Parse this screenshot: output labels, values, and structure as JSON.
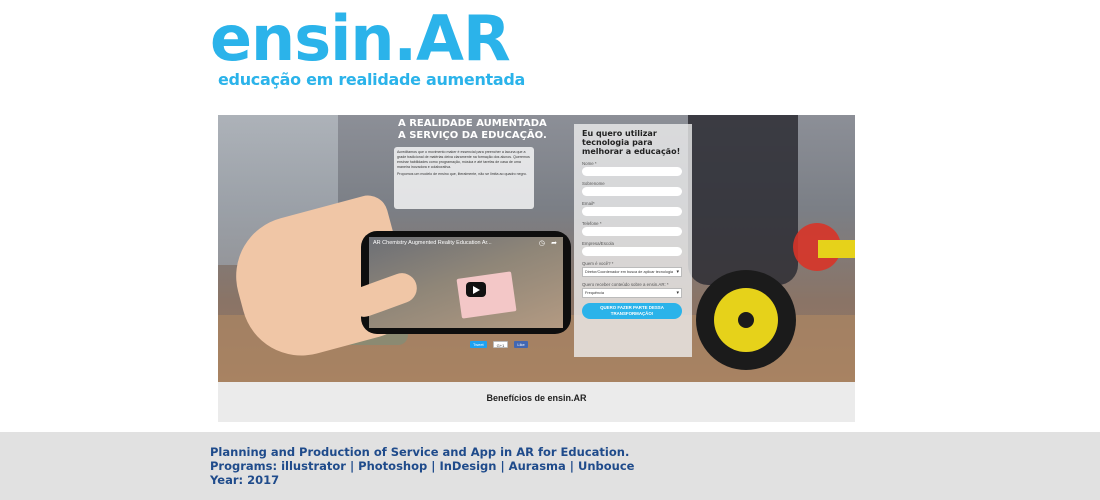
{
  "brand": {
    "name": "ensin.AR",
    "tagline": "educação em realidade aumentada",
    "accent_color": "#2bb3ea"
  },
  "hero": {
    "headline_line1": "A REALIDADE AUMENTADA",
    "headline_line2": "A SERVIÇO DA EDUCAÇÃO.",
    "paragraph1": "Acreditamos que o movimento maker é essencial para preencher a lacuna que a grade tradicional de matérias deixa claramente na formação dos alunos. Queremos ensinar habilidades como programação, música e até tarefas de casa de uma maneira inovadora e colaborativa.",
    "paragraph2": "Propomos um modelo de ensino que, literalmente, não se limita ao quadro negro.",
    "video": {
      "title": "AR Chemistry Augmented Reality Education Ar...",
      "clock_icon": "clock-icon",
      "share_icon": "share-icon",
      "play_icon": "play-icon"
    },
    "social": {
      "tweet": "Tweet",
      "gplus": "G+1",
      "like": "Like"
    }
  },
  "form": {
    "title": "Eu quero utilizar tecnologia para melhorar a educação!",
    "fields": {
      "nome": "Nome *",
      "sobrenome": "Sobrenome",
      "email": "Email*",
      "telefone": "Telefone *",
      "empresa": "Empresa/Escola",
      "quem_e_voce": "Quem é você? *",
      "frequencia_label": "Quero receber conteúdo sobre a ensin.AR: *"
    },
    "quem_e_voce_selected": "Diretor/Coordenador em busca de aplicar tecnologia",
    "frequencia_selected": "Frequência",
    "cta": "QUERO FAZER PARTE DESSA TRANSFORMAÇÃO!"
  },
  "beneficios": "Benefícios de ensin.AR",
  "footer": {
    "line1": "Planning and Production of Service and App in AR for Education.",
    "line2": "Programs: illustrator | Photoshop | InDesign | Aurasma | Unbouce",
    "line3": "Year: 2017",
    "text_color": "#1f4b8b"
  }
}
